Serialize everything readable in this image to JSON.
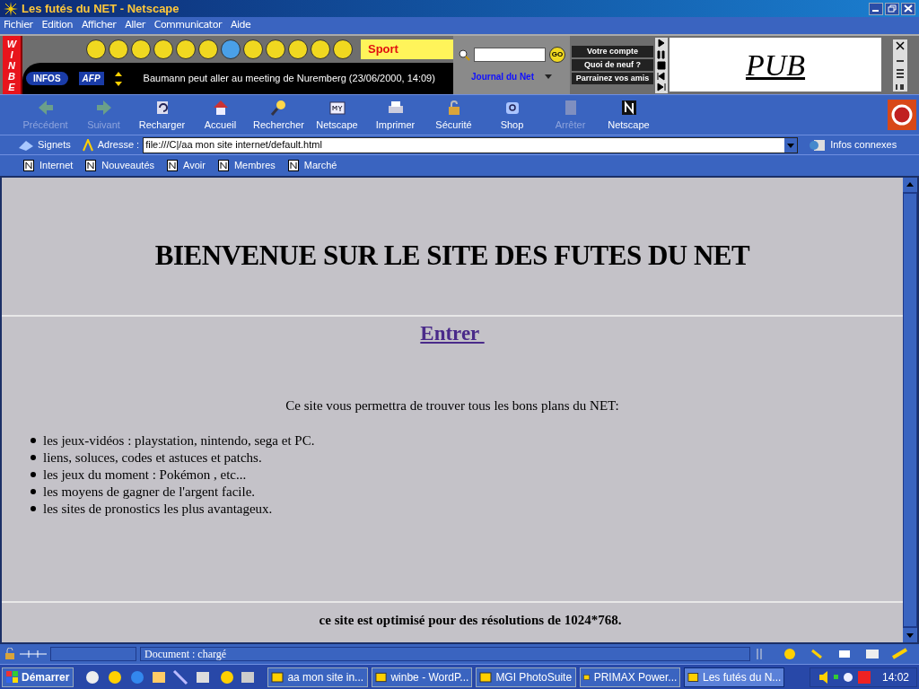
{
  "window": {
    "title": "Les futés du NET - Netscape"
  },
  "menu": [
    "Fichier",
    "Edition",
    "Afficher",
    "Aller",
    "Communicator",
    "Aide"
  ],
  "winbe_bar": {
    "logo": [
      "W",
      "I",
      "N",
      "B",
      "E"
    ],
    "infos_label": "INFOS",
    "agency": "AFP",
    "categories": [
      {
        "selected": false
      },
      {
        "selected": false
      },
      {
        "selected": false
      },
      {
        "selected": false
      },
      {
        "selected": false
      },
      {
        "selected": false
      },
      {
        "selected": true
      },
      {
        "selected": false
      },
      {
        "selected": false
      },
      {
        "selected": false
      },
      {
        "selected": false
      },
      {
        "selected": false
      }
    ],
    "category": "Sport",
    "ticker": "Baumann peut aller au meeting de Nuremberg (23/06/2000, 14:09)",
    "go": "GO",
    "site": "Journal du Net",
    "account_buttons": [
      "Votre compte",
      "Quoi de neuf ?",
      "Parrainez vos amis"
    ],
    "ad": "PUB"
  },
  "nav_toolbar": [
    {
      "label": "Précédent",
      "disabled": true,
      "kind": "back"
    },
    {
      "label": "Suivant",
      "disabled": true,
      "kind": "forward"
    },
    {
      "label": "Recharger",
      "disabled": false,
      "kind": "reload"
    },
    {
      "label": "Accueil",
      "disabled": false,
      "kind": "home"
    },
    {
      "label": "Rechercher",
      "disabled": false,
      "kind": "search"
    },
    {
      "label": "Netscape",
      "disabled": false,
      "kind": "my"
    },
    {
      "label": "Imprimer",
      "disabled": false,
      "kind": "print"
    },
    {
      "label": "Sécurité",
      "disabled": false,
      "kind": "lock"
    },
    {
      "label": "Shop",
      "disabled": false,
      "kind": "shop"
    },
    {
      "label": "Arrêter",
      "disabled": true,
      "kind": "stop"
    },
    {
      "label": "Netscape",
      "disabled": false,
      "kind": "n"
    }
  ],
  "address_bar": {
    "bookmarks": "Signets",
    "label": "Adresse :",
    "value": "file:///C|/aa mon site internet/default.html",
    "related": "Infos connexes"
  },
  "personal_bar": [
    "Internet",
    "Nouveautés",
    "Avoir",
    "Membres",
    "Marché"
  ],
  "page": {
    "heading": "BIENVENUE SUR LE SITE DES FUTES DU NET",
    "link": "Entrer ",
    "intro": "Ce site vous permettra de trouver tous les bons plans du NET:",
    "list": [
      "les jeux-vidéos : playstation, nintendo, sega et PC.",
      "liens, soluces, codes et astuces et patchs.",
      "les jeux du moment : Pokémon , etc...",
      "les moyens de gagner de l'argent facile.",
      "les sites de pronostics les plus avantageux."
    ],
    "footer": "ce site est optimisé pour des résolutions de 1024*768."
  },
  "status_bar": {
    "text": "Document : chargé"
  },
  "taskbar": {
    "start": "Démarrer",
    "tasks": [
      {
        "label": "aa mon site in...",
        "selected": false
      },
      {
        "label": "winbe - WordP...",
        "selected": false
      },
      {
        "label": "MGI PhotoSuite",
        "selected": false
      },
      {
        "label": "PRIMAX Power...",
        "selected": false
      },
      {
        "label": "Les futés du N...",
        "selected": true
      }
    ],
    "clock": "14:02"
  }
}
